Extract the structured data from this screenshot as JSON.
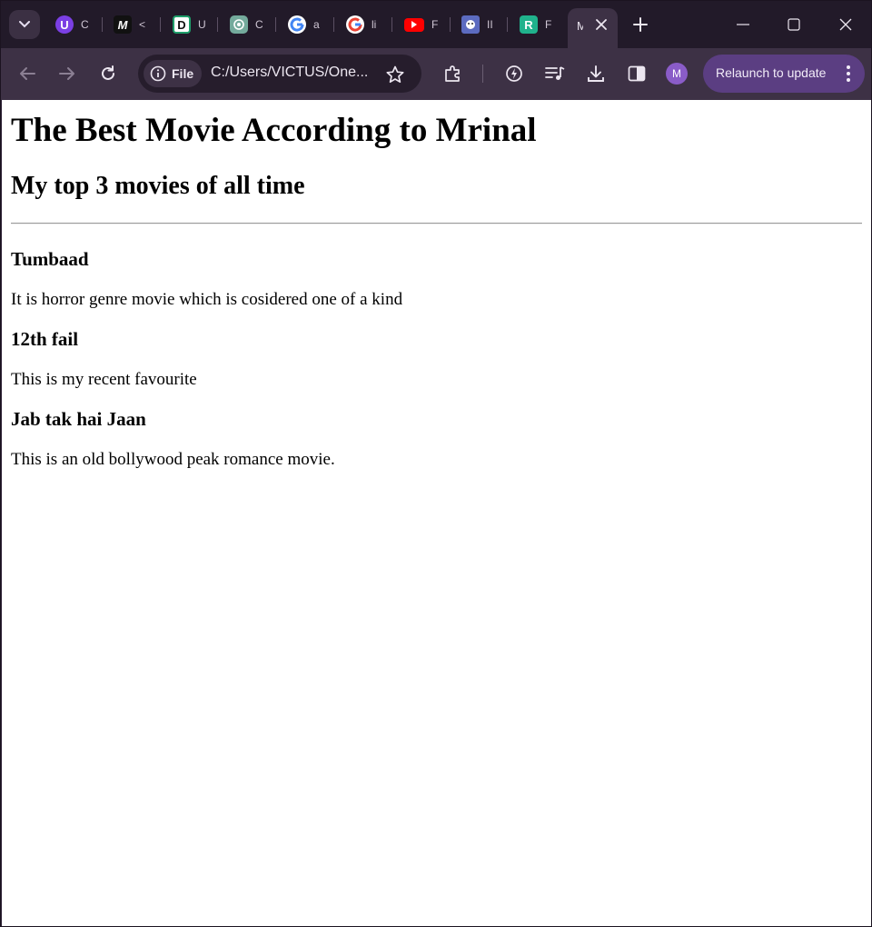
{
  "browser": {
    "tabs": [
      {
        "favicon": "U",
        "favicon_color": "#7b3fe4",
        "title": "C"
      },
      {
        "favicon": "M",
        "favicon_color": "#111111",
        "title": "<"
      },
      {
        "favicon": "D",
        "favicon_color": "#1e9e6a",
        "title": "U"
      },
      {
        "favicon": "chatgpt-icon",
        "favicon_color": "#74aa9c",
        "title": "C"
      },
      {
        "favicon": "google-icon",
        "favicon_color": "#ffffff",
        "title": "a"
      },
      {
        "favicon": "google-icon",
        "favicon_color": "#ffffff",
        "title": "li"
      },
      {
        "favicon": "youtube-icon",
        "favicon_color": "#ff0000",
        "title": "F"
      },
      {
        "favicon": "anime-icon",
        "favicon_color": "#5c6bc0",
        "title": "II"
      },
      {
        "favicon": "R",
        "favicon_color": "#20b28c",
        "title": "F"
      }
    ],
    "active_tab": {
      "title": "M"
    },
    "address_chip": "File",
    "url": "C:/Users/VICTUS/One...",
    "avatar_initial": "M",
    "relaunch_label": "Relaunch to update"
  },
  "page": {
    "title": "The Best Movie According to Mrinal",
    "subtitle": "My top 3 movies of all time",
    "movies": [
      {
        "name": "Tumbaad",
        "description": "It is horror genre movie which is cosidered one of a kind"
      },
      {
        "name": "12th fail",
        "description": "This is my recent favourite"
      },
      {
        "name": "Jab tak hai Jaan",
        "description": "This is an old bollywood peak romance movie."
      }
    ]
  },
  "colors": {
    "tabstrip_bg": "#221a29",
    "toolbar_bg": "#3d3145",
    "relaunch_bg": "#5b3e82",
    "page_bg": "#ffffff"
  }
}
